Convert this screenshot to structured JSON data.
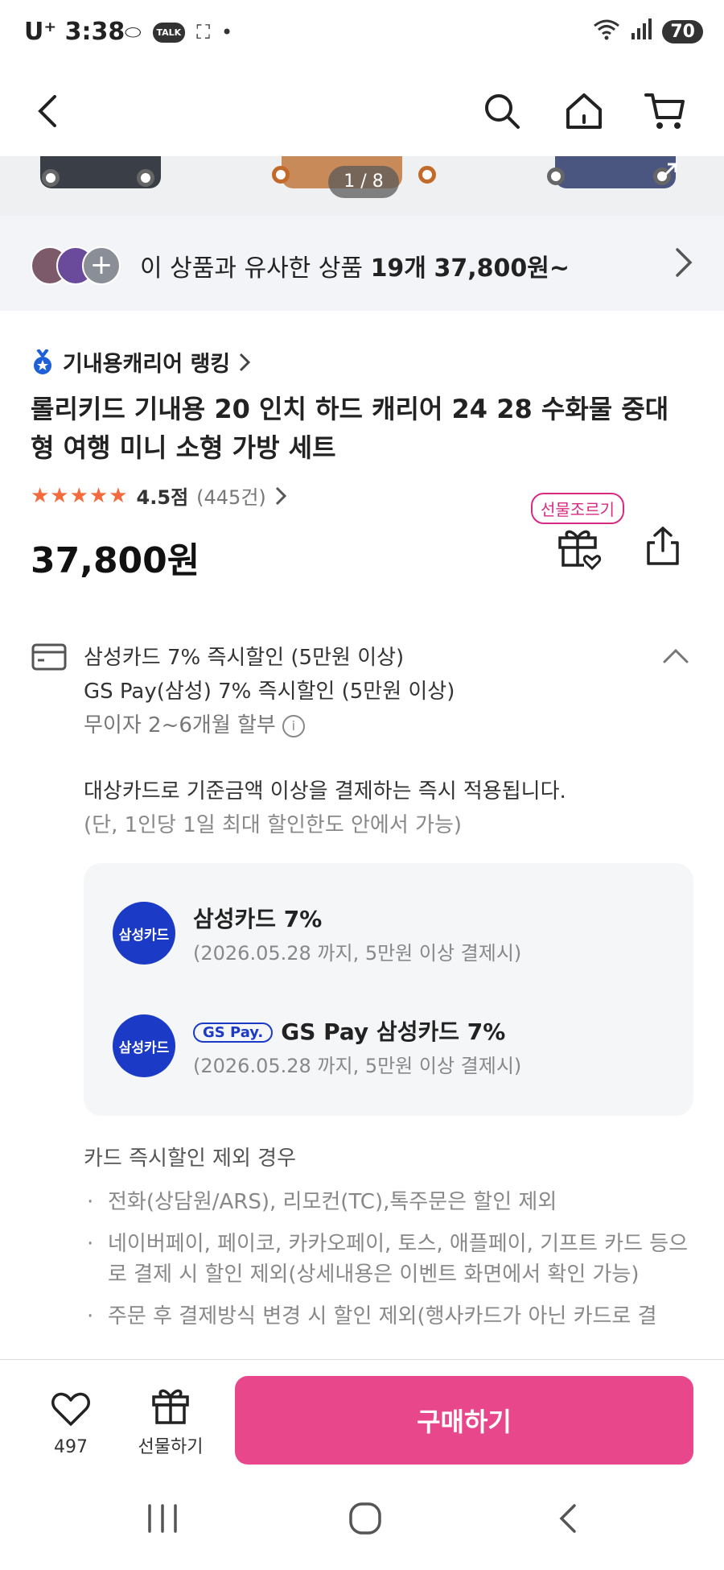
{
  "status_bar": {
    "carrier": "U⁺",
    "time": "3:38",
    "talk_badge": "TALK",
    "battery": "70"
  },
  "image_gallery": {
    "pager": "1 / 8"
  },
  "similar_banner": {
    "text_prefix": "이 상품과 유사한 상품",
    "count": "19개",
    "price": "37,800원~"
  },
  "product": {
    "ranking_label": "기내용캐리어 랭킹",
    "title": "롤리키드 기내용 20 인치 하드 캐리어 24 28 수화물 중대형 여행 미니 소형 가방 세트",
    "stars": "★★★★★",
    "rating": "4.5점",
    "review_count": "(445건)",
    "price": "37,800원",
    "gift_badge": "선물조르기"
  },
  "card_discount": {
    "line1": "삼성카드 7% 즉시할인 (5만원 이상)",
    "line2": "GS Pay(삼성) 7% 즉시할인 (5만원 이상)",
    "line3": "무이자 2~6개월 할부",
    "notice": "대상카드로 기준금액 이상을 결제하는 즉시 적용됩니다.",
    "notice_sub": "(단, 1인당 1일 최대 할인한도 안에서 가능)",
    "cards": [
      {
        "logo": "삼성카드",
        "name": "삼성카드 7%",
        "condition": "(2026.05.28 까지, 5만원 이상 결제시)"
      },
      {
        "logo": "삼성카드",
        "badge": "GS Pay.",
        "name": "GS Pay 삼성카드 7%",
        "condition": "(2026.05.28 까지, 5만원 이상 결제시)"
      }
    ],
    "exclusion_title": "카드 즉시할인 제외 경우",
    "exclusions": [
      "전화(상담원/ARS), 리모컨(TC),톡주문은 할인 제외",
      "네이버페이, 페이코, 카카오페이, 토스, 애플페이, 기프트 카드 등으로 결제 시 할인 제외(상세내용은 이벤트 화면에서 확인 가능)",
      "주문 후 결제방식 변경 시 할인 제외(행사카드가 아닌 카드로 결"
    ]
  },
  "bottom_bar": {
    "like_count": "497",
    "gift_label": "선물하기",
    "buy_label": "구매하기"
  },
  "colors": {
    "accent": "#e8478c",
    "gift_badge": "#d92a83",
    "samsung_blue": "#1b3bc6",
    "star": "#f26a3d"
  },
  "icons": [
    "back-arrow-icon",
    "search-icon",
    "home-icon",
    "cart-icon",
    "medal-icon",
    "chevron-right-icon",
    "gift-icon",
    "share-icon",
    "credit-card-icon",
    "chevron-up-icon",
    "info-icon",
    "heart-icon",
    "recent-apps-icon",
    "home-circle-icon",
    "back-chevron-icon"
  ]
}
